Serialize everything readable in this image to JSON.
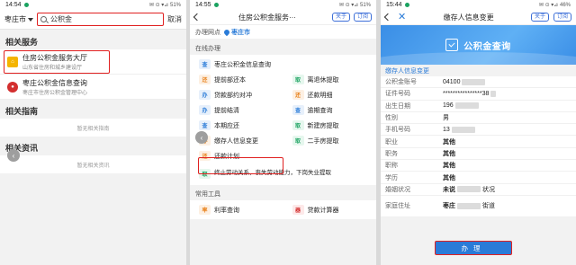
{
  "screen1": {
    "status": {
      "time": "14:54",
      "right": "✉ ⊙ ▾⊿ 51%"
    },
    "search": {
      "city": "枣庄市",
      "query": "公积金",
      "cancel": "取消"
    },
    "sections": {
      "services": "相关服务",
      "guides": "相关指南",
      "news": "相关资讯"
    },
    "results": [
      {
        "title": "住房公积金服务大厅",
        "sub": "山东省住房和城乡建设厅"
      },
      {
        "title": "枣庄公积金信息查询",
        "sub": "枣庄市住房公积金管理中心"
      }
    ],
    "empty_guides": "暂无相关指南",
    "empty_news": "暂无相关资讯"
  },
  "screen2": {
    "status": {
      "time": "14:55",
      "right": "✉ ⊙ ▾⊿ 51%"
    },
    "nav": {
      "title": "住房公积金服务···",
      "follow": "关于",
      "subscribe": "订阅"
    },
    "site": {
      "label": "办理网点",
      "location": "枣庄市"
    },
    "online_label": "在线办理",
    "tools_label": "常用工具",
    "services": [
      {
        "badge": "查",
        "color": "blue",
        "label": "枣庄公积金信息查询"
      },
      {
        "badge": "还",
        "color": "orange",
        "label": "提前部还本"
      },
      {
        "badge": "取",
        "color": "green",
        "label": "离退休提取"
      },
      {
        "badge": "办",
        "color": "blue",
        "label": "贷款部约对冲"
      },
      {
        "badge": "还",
        "color": "orange",
        "label": "还款明细"
      },
      {
        "badge": "办",
        "color": "blue",
        "label": "提前结清"
      },
      {
        "badge": "查",
        "color": "blue",
        "label": "逾期查询"
      },
      {
        "badge": "查",
        "color": "blue",
        "label": "本期应还"
      },
      {
        "badge": "取",
        "color": "green",
        "label": "新建房提取"
      },
      {
        "badge": "办",
        "color": "orange",
        "label": "缴存人信息变更"
      },
      {
        "badge": "取",
        "color": "green",
        "label": "二手房提取"
      },
      {
        "badge": "还",
        "color": "orange",
        "label": "还款计划"
      },
      {
        "badge": "取",
        "color": "green",
        "label": "终止劳动关系，丧失劳动能力，下岗失业提取"
      }
    ],
    "tools": [
      {
        "badge": "率",
        "color": "orange",
        "label": "利率查询"
      },
      {
        "badge": "器",
        "color": "red",
        "label": "贷款计算器"
      }
    ]
  },
  "screen3": {
    "status": {
      "time": "15:44",
      "right": "✉ ⊙ ▾⊿ 46%"
    },
    "nav": {
      "title": "缴存人信息变更",
      "follow": "关于",
      "subscribe": "订阅"
    },
    "banner": "公积金查询",
    "section": "缴存人信息变更",
    "fields": [
      {
        "k": "公积金账号",
        "v": "04100",
        "masked": true
      },
      {
        "k": "证件号码",
        "v": "****************38",
        "masked": true
      },
      {
        "k": "出生日期",
        "v": "196",
        "masked": true
      },
      {
        "k": "性别",
        "v": "男",
        "masked": false
      },
      {
        "k": "手机号码",
        "v": "13",
        "masked": true
      },
      {
        "k": "职业",
        "v": "其他",
        "masked": false
      },
      {
        "k": "职务",
        "v": "其他",
        "masked": false
      },
      {
        "k": "职称",
        "v": "其他",
        "masked": false
      },
      {
        "k": "学历",
        "v": "其他",
        "masked": false
      },
      {
        "k": "婚姻状况",
        "v": "未说",
        "masked": true
      },
      {
        "k": "家庭住址",
        "v": "枣庄",
        "masked": true
      }
    ],
    "masked_suffix": {
      "marital": "状况",
      "address": "街道"
    },
    "submit": "办理"
  }
}
